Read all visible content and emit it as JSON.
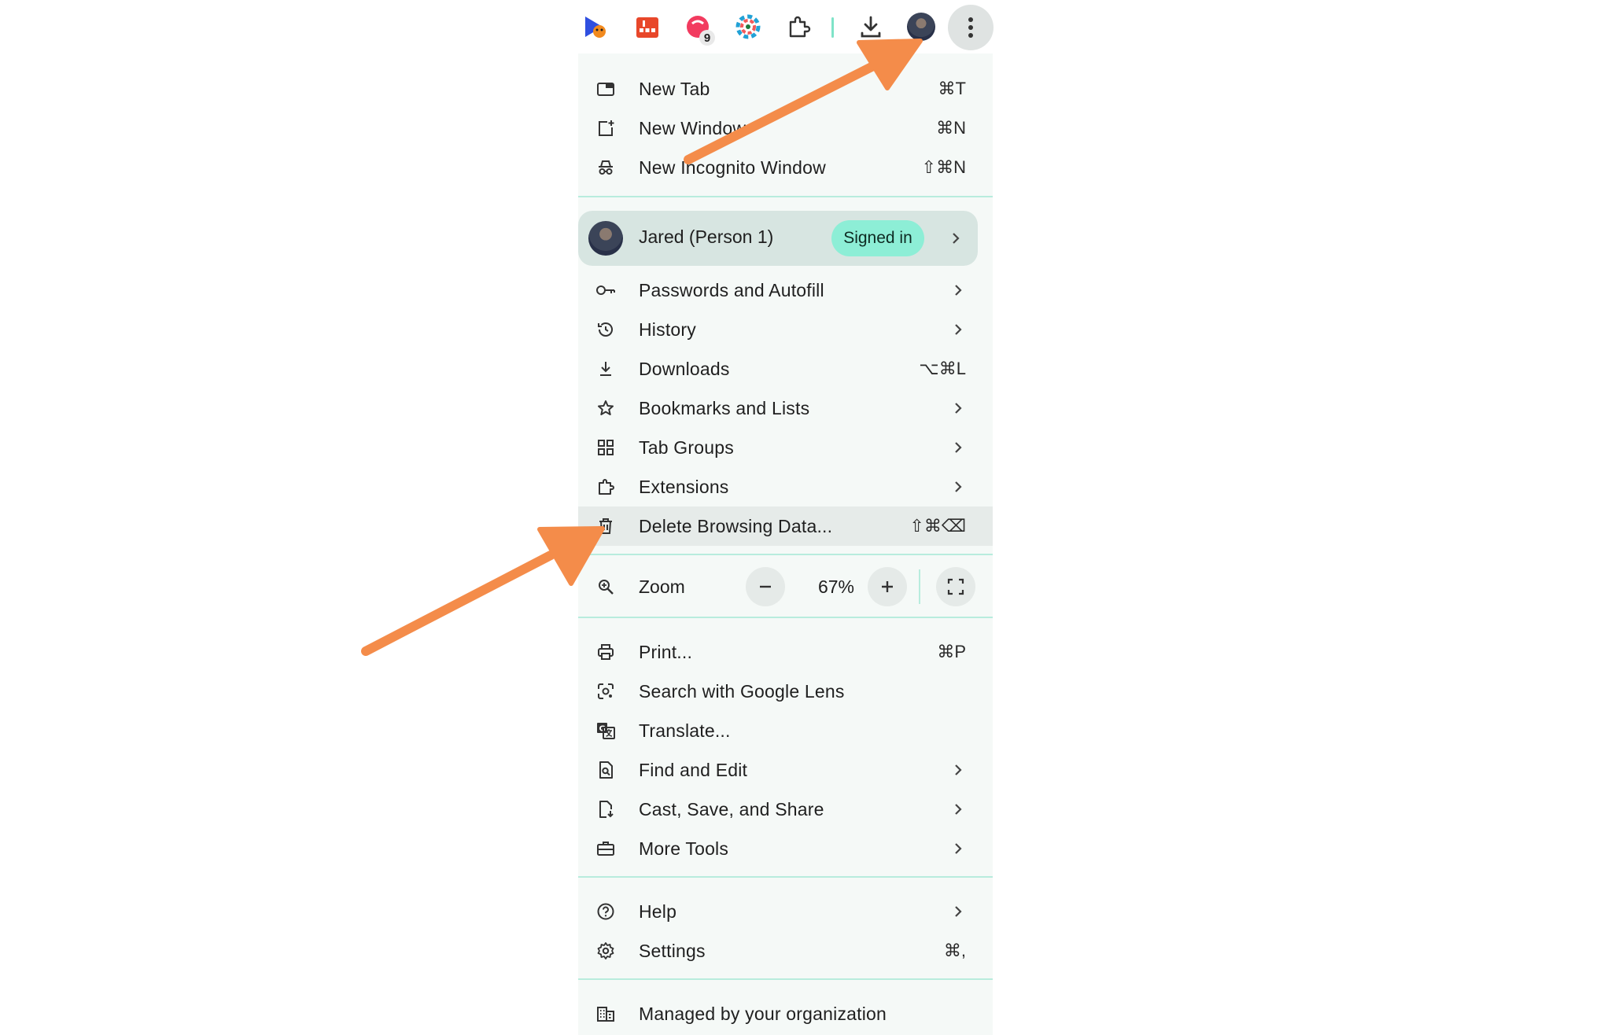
{
  "toolbar": {
    "extensions": [
      {
        "name": "pixel-tracker-extension",
        "color": "#2f4fe0"
      },
      {
        "name": "sheets-extension",
        "color": "#e8472a"
      },
      {
        "name": "red-extension",
        "color": "#f23b5f",
        "badge": "9"
      },
      {
        "name": "color-wheel-extension",
        "color": "#21a1d6"
      }
    ],
    "accent": "#7fe3c8"
  },
  "menu": {
    "group1": [
      {
        "label": "New Tab",
        "shortcut": "⌘T",
        "icon": "new-tab-icon"
      },
      {
        "label": "New Window",
        "shortcut": "⌘N",
        "icon": "new-window-icon"
      },
      {
        "label": "New Incognito Window",
        "shortcut": "⇧⌘N",
        "icon": "incognito-icon"
      }
    ],
    "profile": {
      "name": "Jared (Person 1)",
      "status": "Signed in"
    },
    "group2": [
      {
        "label": "Passwords and Autofill",
        "icon": "key-icon",
        "submenu": true
      },
      {
        "label": "History",
        "icon": "history-icon",
        "submenu": true
      },
      {
        "label": "Downloads",
        "shortcut": "⌥⌘L",
        "icon": "download-icon"
      },
      {
        "label": "Bookmarks and Lists",
        "icon": "star-icon",
        "submenu": true
      },
      {
        "label": "Tab Groups",
        "icon": "grid-icon",
        "submenu": true
      },
      {
        "label": "Extensions",
        "icon": "puzzle-icon",
        "submenu": true
      },
      {
        "label": "Delete Browsing Data...",
        "shortcut": "⇧⌘⌫",
        "icon": "trash-icon"
      }
    ],
    "zoom": {
      "label": "Zoom",
      "value": "67%",
      "minus": "−",
      "plus": "+"
    },
    "group3": [
      {
        "label": "Print...",
        "shortcut": "⌘P",
        "icon": "print-icon"
      },
      {
        "label": "Search with Google Lens",
        "icon": "lens-icon"
      },
      {
        "label": "Translate...",
        "icon": "translate-icon"
      },
      {
        "label": "Find and Edit",
        "icon": "find-icon",
        "submenu": true
      },
      {
        "label": "Cast, Save, and Share",
        "icon": "cast-save-icon",
        "submenu": true
      },
      {
        "label": "More Tools",
        "icon": "toolbox-icon",
        "submenu": true
      }
    ],
    "group4": [
      {
        "label": "Help",
        "icon": "help-icon",
        "submenu": true
      },
      {
        "label": "Settings",
        "shortcut": "⌘,",
        "icon": "settings-icon"
      }
    ],
    "managed": {
      "label": "Managed by your organization",
      "icon": "building-icon"
    }
  },
  "annotation_color": "#f48c4a"
}
